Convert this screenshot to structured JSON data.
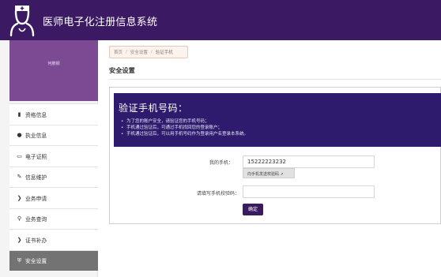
{
  "app": {
    "title": "医师电子化注册信息系统"
  },
  "user": {
    "name": "何鹏钢"
  },
  "sidebar": {
    "items": [
      {
        "label": "资格信息",
        "icon": "book-icon"
      },
      {
        "label": "执业信息",
        "icon": "users-icon"
      },
      {
        "label": "电子证照",
        "icon": "card-icon"
      },
      {
        "label": "信息维护",
        "icon": "edit-icon"
      },
      {
        "label": "业务申请",
        "icon": "chevron-right-icon"
      },
      {
        "label": "业务查询",
        "icon": "search-icon"
      },
      {
        "label": "证书补办",
        "icon": "chevron-right-icon"
      },
      {
        "label": "安全设置",
        "icon": "shield-icon",
        "active": true
      }
    ]
  },
  "breadcrumb": {
    "home": "首页",
    "section": "安全设置",
    "current": "验证手机"
  },
  "page": {
    "title": "安全设置"
  },
  "banner": {
    "title": "验证手机号码：",
    "notes": [
      "为了您的账户安全，请验证您的手机号码；",
      "手机通过验证后，可通过手机找回您的登录账户；",
      "手机通过验证后，可以用手机号码作为登录用户名登录本系统。"
    ]
  },
  "form": {
    "phone_label": "我的手机：",
    "phone_value": "15222223232",
    "send_button": "向手机发送校验码",
    "code_label": "请填写手机校验码：",
    "code_value": "",
    "confirm_button": "确定"
  },
  "colors": {
    "header": "#3b1a63",
    "profile": "#7c4a92",
    "banner": "#2e1b6e",
    "active_menu": "#737373"
  }
}
